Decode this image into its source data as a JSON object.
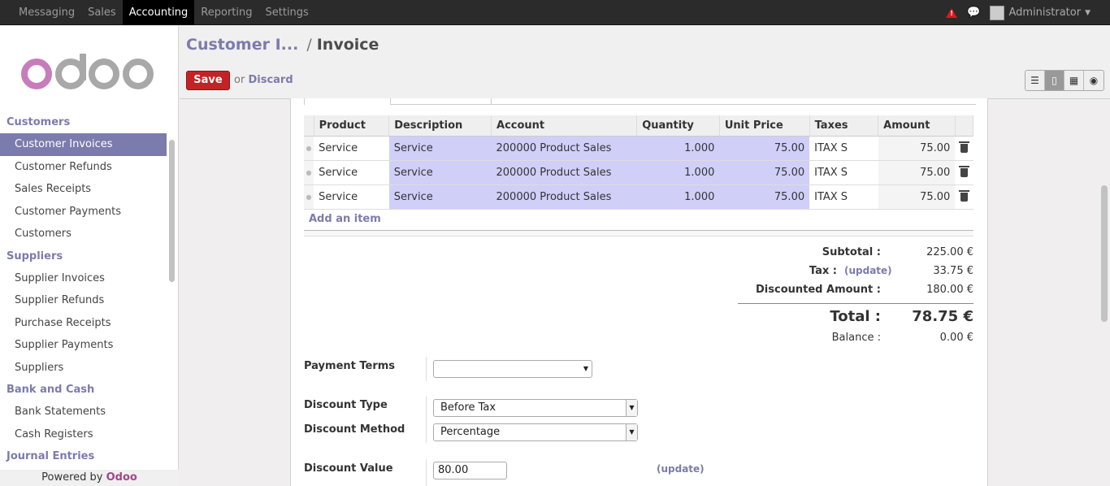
{
  "topbar": {
    "menu": [
      "Messaging",
      "Sales",
      "Accounting",
      "Reporting",
      "Settings"
    ],
    "active_index": 2,
    "user": "Administrator"
  },
  "sidebar": {
    "logo_text": "odoo",
    "sections": [
      {
        "title": "Customers",
        "items": [
          "Customer Invoices",
          "Customer Refunds",
          "Sales Receipts",
          "Customer Payments",
          "Customers"
        ]
      },
      {
        "title": "Suppliers",
        "items": [
          "Supplier Invoices",
          "Supplier Refunds",
          "Purchase Receipts",
          "Supplier Payments",
          "Suppliers"
        ]
      },
      {
        "title": "Bank and Cash",
        "items": [
          "Bank Statements",
          "Cash Registers"
        ]
      },
      {
        "title": "Journal Entries",
        "items": []
      }
    ],
    "active_item": "Customer Invoices",
    "powered_prefix": "Powered by",
    "powered_brand": "Odoo"
  },
  "header": {
    "breadcrumb_parent": "Customer I...",
    "breadcrumb_sep": "/",
    "breadcrumb_current": "Invoice",
    "save_label": "Save",
    "or_label": "or",
    "discard_label": "Discard"
  },
  "invoice_lines": {
    "columns": [
      "Product",
      "Description",
      "Account",
      "Quantity",
      "Unit Price",
      "Taxes",
      "Amount"
    ],
    "rows": [
      {
        "product": "Service",
        "description": "Service",
        "account": "200000 Product Sales",
        "quantity": "1.000",
        "unit_price": "75.00",
        "taxes": "ITAX S",
        "amount": "75.00"
      },
      {
        "product": "Service",
        "description": "Service",
        "account": "200000 Product Sales",
        "quantity": "1.000",
        "unit_price": "75.00",
        "taxes": "ITAX S",
        "amount": "75.00"
      },
      {
        "product": "Service",
        "description": "Service",
        "account": "200000 Product Sales",
        "quantity": "1.000",
        "unit_price": "75.00",
        "taxes": "ITAX S",
        "amount": "75.00"
      }
    ],
    "add_item_label": "Add an item"
  },
  "totals": {
    "subtotal_label": "Subtotal :",
    "subtotal": "225.00 €",
    "tax_label": "Tax :",
    "tax_update": "(update)",
    "tax": "33.75 €",
    "discounted_label": "Discounted Amount :",
    "discounted": "180.00 €",
    "total_label": "Total :",
    "total": "78.75 €",
    "balance_label": "Balance :",
    "balance": "0.00 €"
  },
  "form": {
    "payment_terms_label": "Payment Terms",
    "payment_terms_value": "",
    "discount_type_label": "Discount Type",
    "discount_type_value": "Before Tax",
    "discount_method_label": "Discount Method",
    "discount_method_value": "Percentage",
    "discount_value_label": "Discount Value",
    "discount_value": "80.00",
    "update_label": "(update)"
  }
}
